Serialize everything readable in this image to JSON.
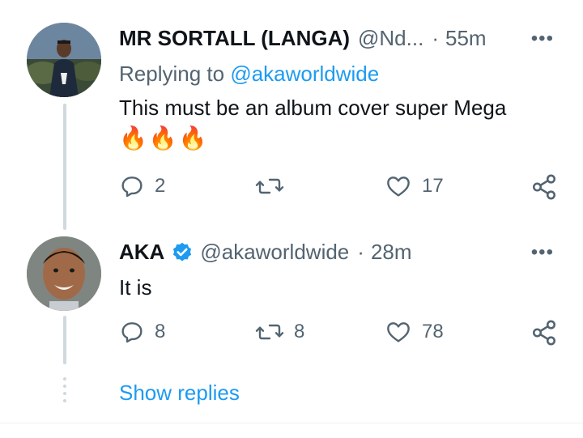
{
  "tweets": [
    {
      "author_name": "MR SORTALL (LANGA)",
      "handle": "@Nd...",
      "separator": "·",
      "time": "55m",
      "replying_label": "Replying to",
      "replying_to": "@akaworldwide",
      "text": "This must be an album cover super Mega",
      "emoji_line": "🔥🔥🔥",
      "replies": "2",
      "retweets": "",
      "likes": "17",
      "more_label": "•••"
    },
    {
      "author_name": "AKA",
      "verified": true,
      "handle": "@akaworldwide",
      "separator": "·",
      "time": "28m",
      "text": "It is",
      "replies": "8",
      "retweets": "8",
      "likes": "78",
      "more_label": "•••"
    }
  ],
  "show_replies_label": "Show replies",
  "colors": {
    "link": "#1d9bf0",
    "secondary_text": "#536471",
    "thread_line": "#cfd9de",
    "primary_text": "#0f1419"
  }
}
